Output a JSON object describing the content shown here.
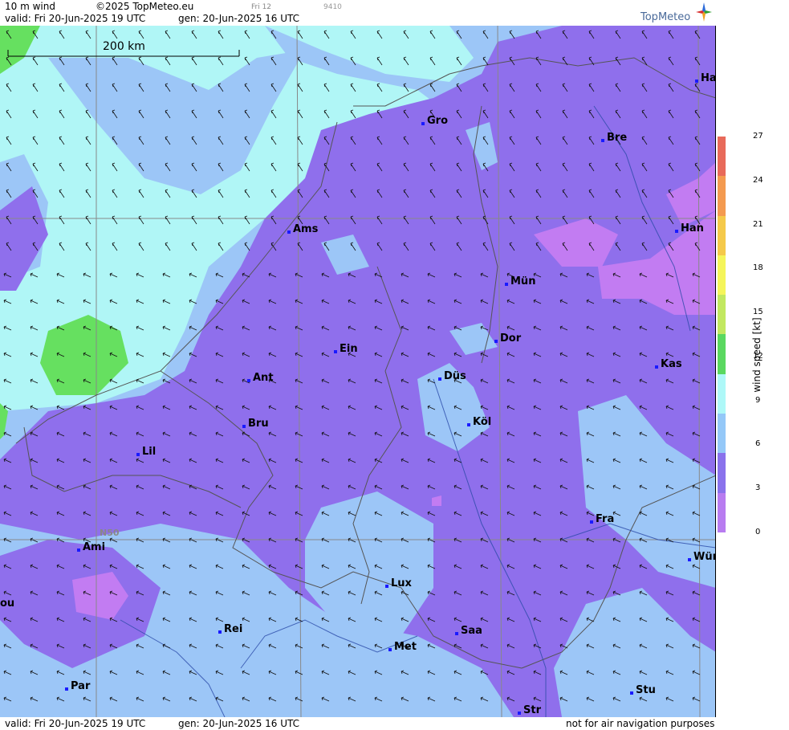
{
  "header": {
    "product": "10 m wind",
    "copyright": "©2025 TopMeteo.eu",
    "valid": "valid:  Fri  20-Jun-2025  19 UTC",
    "gen": "gen: 20-Jun-2025 16 UTC",
    "small_label": "Fri 12",
    "small_code": "9410",
    "brand": "TopMeteo"
  },
  "footer": {
    "valid": "valid:  Fri  20-Jun-2025  19 UTC",
    "gen": "gen: 20-Jun-2025 16 UTC",
    "disclaimer": "not for air navigation purposes"
  },
  "map": {
    "scale_label": "200 km",
    "latitude_label": "N50",
    "cities": [
      "Ha",
      "Gro",
      "Bre",
      "Ams",
      "Han",
      "Mün",
      "Ein",
      "Dor",
      "Kas",
      "Düs",
      "Ant",
      "Köl",
      "Bru",
      "Lil",
      "Fra",
      "Ami",
      "Wür",
      "Lux",
      "ou",
      "Rei",
      "Saa",
      "Met",
      "Par",
      "Stu",
      "Str"
    ]
  },
  "legend": {
    "title": "wind  speed  [kt]",
    "ticks": [
      "27",
      "24",
      "21",
      "18",
      "15",
      "12",
      "9",
      "6",
      "3",
      "0"
    ],
    "colors": [
      "#e86a5a",
      "#f49a50",
      "#f5c94a",
      "#f5f55a",
      "#c2e860",
      "#5ad860",
      "#aef8f8",
      "#94c8f8",
      "#8a72ec",
      "#b87cf0"
    ]
  },
  "colors": {
    "calm": "#c27cf2",
    "light": "#8f6fec",
    "moderate": "#9cc6f7",
    "fresh": "#b0f6f6",
    "strong": "#66e060"
  }
}
